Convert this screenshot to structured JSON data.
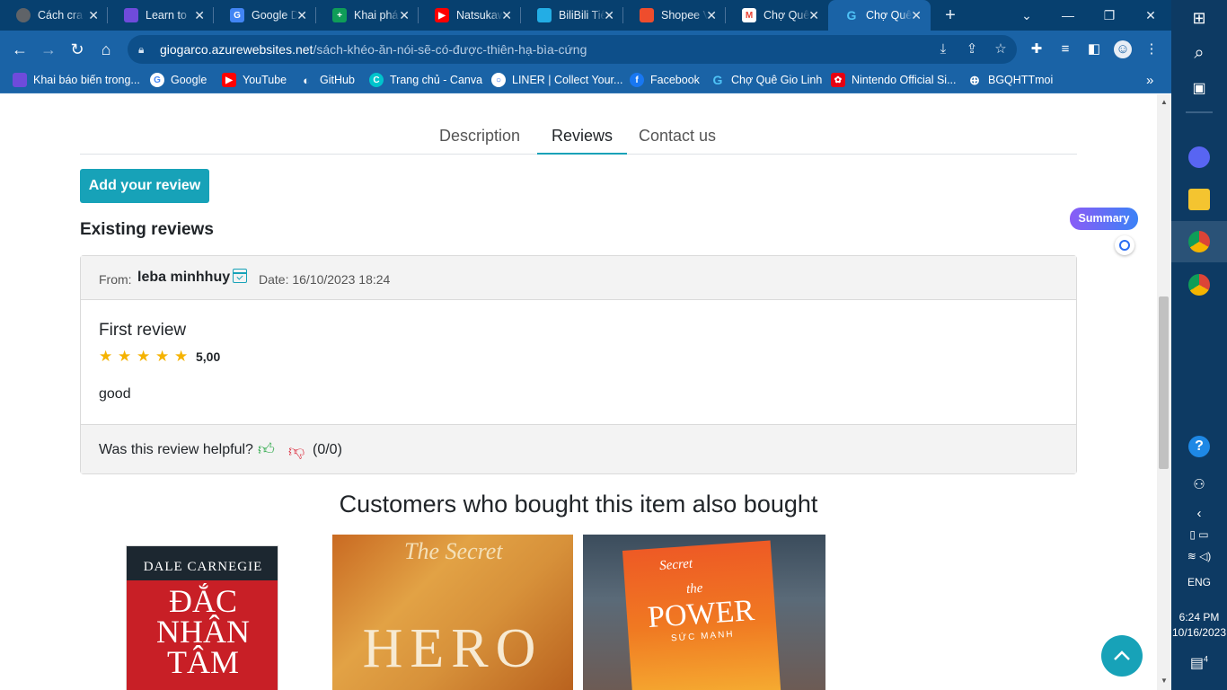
{
  "browser": {
    "tabs": [
      {
        "title": "Cách cra",
        "icon": "globe-icon",
        "color": "#5f6368",
        "glyph": ""
      },
      {
        "title": "Learn to",
        "icon": "app-icon",
        "color": "#6f4bdb",
        "glyph": ""
      },
      {
        "title": "Google Dịch",
        "icon": "google-translate-icon",
        "color": "#4285f4",
        "glyph": "G"
      },
      {
        "title": "Khai phá",
        "icon": "green-plus-icon",
        "color": "#0f9d58",
        "glyph": "+"
      },
      {
        "title": "Natsukawa",
        "icon": "youtube-icon",
        "color": "#ff0000",
        "glyph": "▶"
      },
      {
        "title": "BiliBili Tiếng",
        "icon": "bilibili-icon",
        "color": "#23ade5",
        "glyph": ""
      },
      {
        "title": "Shopee Việt",
        "icon": "shopee-icon",
        "color": "#ee4d2d",
        "glyph": ""
      },
      {
        "title": "Chợ Quê",
        "icon": "gmail-icon",
        "color": "#ea4335",
        "glyph": "M"
      },
      {
        "title": "Chợ Quê",
        "icon": "site-g-icon",
        "color": "#1a63a6",
        "glyph": "G"
      }
    ],
    "new_tab": "+",
    "window_controls": {
      "chevron": "⌄",
      "minimize": "—",
      "restore": "❐",
      "close": "✕"
    },
    "url": {
      "domain": "giogarco.azurewebsites.net",
      "path": "/sách-khéo-ăn-nói-sẽ-có-được-thiên-hạ-bìa-cứng"
    },
    "bookmarks": [
      {
        "label": "Khai báo biến trong...",
        "icon": "app-icon",
        "color": "#6f4bdb",
        "glyph": ""
      },
      {
        "label": "Google",
        "icon": "google-icon",
        "color": "#ffffff",
        "glyph": "G"
      },
      {
        "label": "YouTube",
        "icon": "youtube-icon",
        "color": "#ff0000",
        "glyph": "▶"
      },
      {
        "label": "GitHub",
        "icon": "github-icon",
        "color": "#1a63a6",
        "glyph": "◐"
      },
      {
        "label": "Trang chủ - Canva",
        "icon": "canva-icon",
        "color": "#00c4cc",
        "glyph": "C"
      },
      {
        "label": "LINER | Collect Your...",
        "icon": "liner-icon",
        "color": "#2b6df3",
        "glyph": "○"
      },
      {
        "label": "Facebook",
        "icon": "facebook-icon",
        "color": "#1877f2",
        "glyph": "f"
      },
      {
        "label": "Chợ Quê Gio Linh",
        "icon": "site-g-icon",
        "color": "#1a63a6",
        "glyph": "G"
      },
      {
        "label": "Nintendo Official Si...",
        "icon": "mario-icon",
        "color": "#e60012",
        "glyph": "✿"
      },
      {
        "label": "BGQHTTmoi",
        "icon": "globe-icon",
        "color": "#1a63a6",
        "glyph": "⊕"
      }
    ],
    "more_bookmarks": "»"
  },
  "page": {
    "tabs": [
      {
        "label": "Description",
        "active": false
      },
      {
        "label": "Reviews",
        "active": true
      },
      {
        "label": "Contact us",
        "active": false
      }
    ],
    "add_review": "Add your review",
    "existing_heading": "Existing reviews",
    "review": {
      "from_label": "From:",
      "author": "leba minhhuy",
      "date": "Date: 16/10/2023 18:24",
      "title": "First review",
      "stars": 5,
      "rating": "5,00",
      "body": "good",
      "helpful_q": "Was this review helpful?",
      "votes": "(0/0)"
    },
    "also_bought_heading": "Customers who bought this item also bought",
    "books": [
      {
        "author": "DALE CARNEGIE",
        "title_lines": [
          "ĐẮC",
          "NHÂN",
          "TÂM"
        ]
      },
      {
        "series": "The Secret",
        "title": "HERO"
      },
      {
        "series": "Secret",
        "prefix": "the",
        "title": "POWER",
        "subtitle": "SỨC MẠNH"
      }
    ],
    "summary_badge": "Summary"
  },
  "taskbar": {
    "lang": "ENG",
    "time": "6:24 PM",
    "date": "10/16/2023",
    "notifications": "4"
  },
  "colors": {
    "accent": "#17a2b8",
    "star": "#f5b301",
    "browser": "#1a63a6"
  }
}
